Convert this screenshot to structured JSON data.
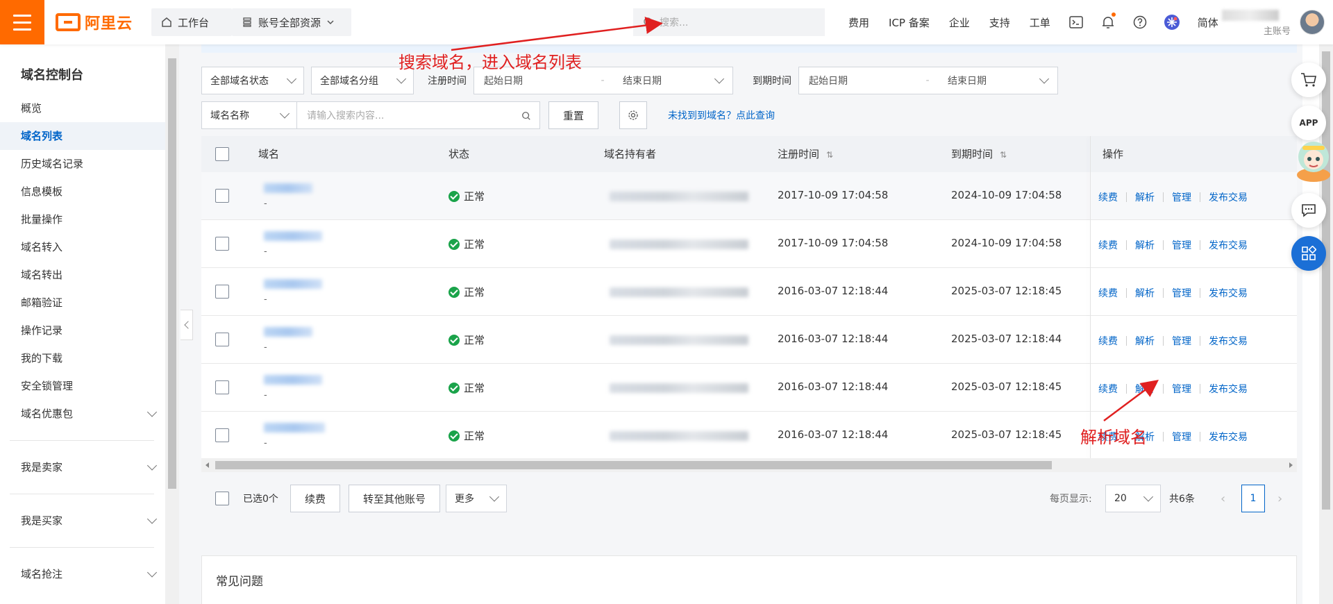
{
  "topbar": {
    "brand": "阿里云",
    "workbench": "工作台",
    "resources": "账号全部资源",
    "search_placeholder": "搜索...",
    "links": [
      "费用",
      "ICP 备案",
      "企业",
      "支持",
      "工单"
    ],
    "lang": "简体",
    "account_label": "主账号"
  },
  "sidebar": {
    "title": "域名控制台",
    "items": [
      "概览",
      "域名列表",
      "历史域名记录",
      "信息模板",
      "批量操作",
      "域名转入",
      "域名转出",
      "邮箱验证",
      "操作记录",
      "我的下载",
      "安全锁管理",
      "域名优惠包"
    ],
    "groups": [
      "我是卖家",
      "我是买家",
      "域名抢注"
    ]
  },
  "filters": {
    "status": "全部域名状态",
    "group": "全部域名分组",
    "reg_label": "注册时间",
    "exp_label": "到期时间",
    "start": "起始日期",
    "end": "结束日期",
    "field": "域名名称",
    "search_placeholder": "请输入搜索内容...",
    "reset": "重置",
    "not_found": "未找到到域名？点此查询"
  },
  "table": {
    "headers": [
      "域名",
      "状态",
      "域名持有者",
      "注册时间",
      "到期时间",
      "操作"
    ],
    "ops": [
      "续费",
      "解析",
      "管理",
      "发布交易"
    ],
    "rows": [
      {
        "sub": "-",
        "status": "正常",
        "reg": "2017-10-09 17:04:58",
        "exp": "2024-10-09 17:04:58"
      },
      {
        "sub": "-",
        "status": "正常",
        "reg": "2017-10-09 17:04:58",
        "exp": "2024-10-09 17:04:58"
      },
      {
        "sub": "-",
        "status": "正常",
        "reg": "2016-03-07 12:18:44",
        "exp": "2025-03-07 12:18:45"
      },
      {
        "sub": "-",
        "status": "正常",
        "reg": "2016-03-07 12:18:44",
        "exp": "2025-03-07 12:18:44"
      },
      {
        "sub": "-",
        "status": "正常",
        "reg": "2016-03-07 12:18:44",
        "exp": "2025-03-07 12:18:45"
      },
      {
        "sub": "-",
        "status": "正常",
        "reg": "2016-03-07 12:18:44",
        "exp": "2025-03-07 12:18:45"
      }
    ]
  },
  "footer": {
    "selected": "已选0个",
    "renew": "续费",
    "transfer": "转至其他账号",
    "more": "更多",
    "per_page_label": "每页显示:",
    "per_page": "20",
    "total": "共6条",
    "page": "1"
  },
  "faq": {
    "title": "常见问题"
  },
  "float": {
    "app": "APP"
  },
  "annotations": {
    "search": "搜索域名，进入域名列表",
    "resolve": "解析域名"
  },
  "colors": {
    "brand": "#ff6a00",
    "link": "#0064c8",
    "ok": "#1aa34a",
    "annotation": "#e02020"
  }
}
